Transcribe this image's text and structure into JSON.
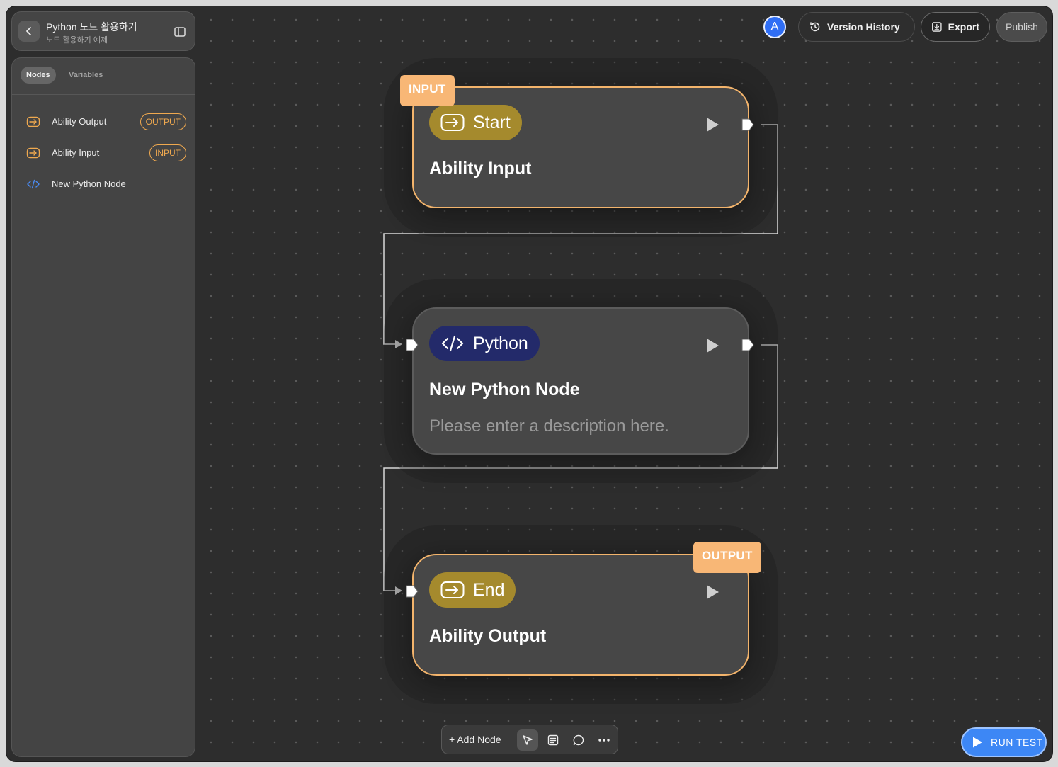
{
  "project": {
    "title": "Python 노드 활용하기",
    "subtitle": "노드 활용하기 예제"
  },
  "sidebar": {
    "tabs": [
      "Nodes",
      "Variables"
    ],
    "items": [
      {
        "label": "Ability Output",
        "badge": "OUTPUT",
        "icon": "input-arrow-icon"
      },
      {
        "label": "Ability Input",
        "badge": "INPUT",
        "icon": "input-arrow-icon"
      },
      {
        "label": "New Python Node",
        "badge": "",
        "icon": "code-icon"
      }
    ]
  },
  "toolbar": {
    "avatar_letter": "A",
    "version_history": "Version History",
    "export": "Export",
    "publish": "Publish"
  },
  "nodes": {
    "start": {
      "tag": "INPUT",
      "pill": "Start",
      "title": "Ability Input"
    },
    "python": {
      "pill": "Python",
      "title": "New Python Node",
      "description": "Please enter a description here."
    },
    "end": {
      "tag": "OUTPUT",
      "pill": "End",
      "title": "Ability Output"
    }
  },
  "bottom_bar": {
    "add_node": "+ Add Node"
  },
  "run_test": "RUN TEST",
  "colors": {
    "accent_orange": "#f3b46c",
    "start_pill": "#a58a2d",
    "python_pill": "#232a6a",
    "run_test_blue": "#3d87f5",
    "avatar_blue": "#2f6ef5"
  }
}
